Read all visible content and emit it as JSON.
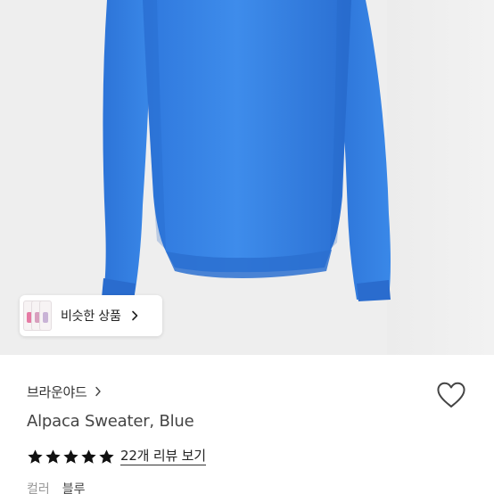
{
  "product_image": {
    "subject": "sweater-image",
    "colors": {
      "sweater": "#3b86e6",
      "background": "#eeeeee"
    }
  },
  "similar_products": {
    "label": "비슷한 상품",
    "thumbnail_colors": [
      "#e67aa4",
      "#d89fbe",
      "#c9b3d6"
    ]
  },
  "brand": {
    "name": "브라운야드"
  },
  "product": {
    "title": "Alpaca Sweater, Blue"
  },
  "rating": {
    "stars": 5,
    "star_color": "#111111",
    "review_link_label": "22개 리뷰 보기"
  },
  "options": {
    "color_label": "컬러",
    "color_value": "블루"
  }
}
